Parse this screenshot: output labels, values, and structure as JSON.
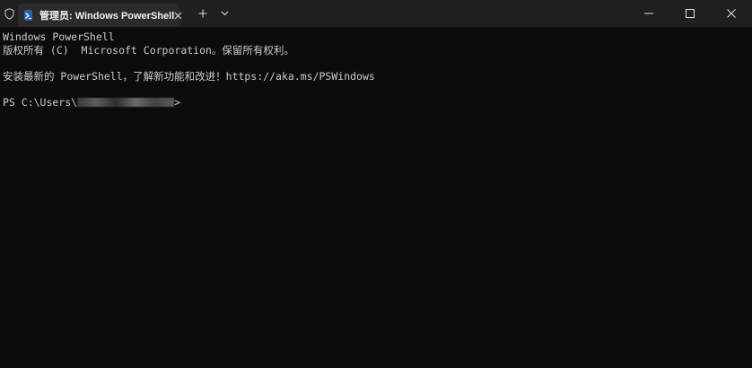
{
  "window": {
    "tab_title": "管理员: Windows PowerShell",
    "icons": {
      "shield": "shield-icon",
      "tab": "powershell-icon",
      "close_tab": "close-icon",
      "new_tab": "plus-icon",
      "dropdown": "chevron-down-icon",
      "minimize": "minimize-icon",
      "maximize": "maximize-icon",
      "close_window": "close-icon"
    },
    "colors": {
      "titlebar": "#1f1f1f",
      "tab": "#2b2b2b",
      "terminal_bg": "#0c0c0c",
      "terminal_fg": "#cccccc"
    }
  },
  "terminal": {
    "line1": "Windows PowerShell",
    "line2": "版权所有 (C)  Microsoft Corporation。保留所有权利。",
    "line3": "安装最新的 PowerShell，了解新功能和改进！https://aka.ms/PSWindows",
    "prompt_prefix": "PS C:\\Users\\",
    "prompt_suffix": ">"
  }
}
